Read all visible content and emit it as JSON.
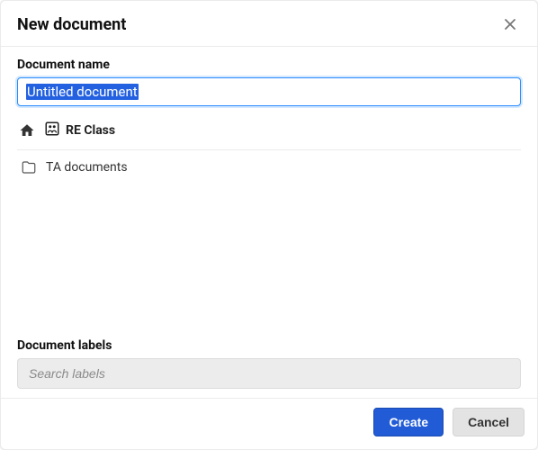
{
  "dialog": {
    "title": "New document",
    "name_field": {
      "label": "Document name",
      "value": "Untitled document"
    },
    "breadcrumb": {
      "location_name": "RE Class"
    },
    "files": [
      {
        "name": "TA documents",
        "type": "folder"
      }
    ],
    "labels_field": {
      "label": "Document labels",
      "placeholder": "Search labels",
      "value": ""
    },
    "buttons": {
      "create": "Create",
      "cancel": "Cancel"
    }
  }
}
